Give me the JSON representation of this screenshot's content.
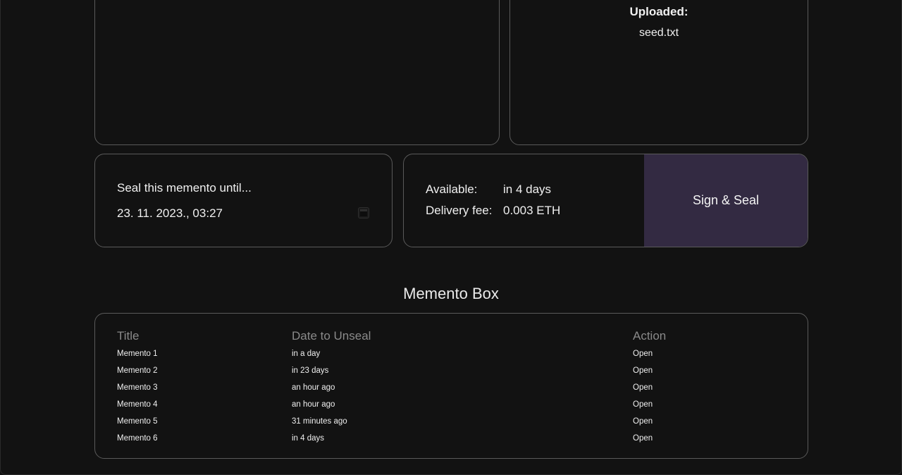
{
  "upload": {
    "uploaded_label": "Uploaded:",
    "file_name": "seed.txt"
  },
  "seal": {
    "label": "Seal this memento until...",
    "date_value": "23. 11. 2023., 03:27"
  },
  "delivery": {
    "available_label": "Available:",
    "available_value": "in 4 days",
    "fee_label": "Delivery fee:",
    "fee_value": "0.003 ETH",
    "sign_button_label": "Sign & Seal"
  },
  "memento_box": {
    "heading": "Memento Box",
    "columns": [
      "Title",
      "Date to Unseal",
      "Action"
    ],
    "rows": [
      {
        "title": "Memento 1",
        "date": "in a day",
        "action": "Open"
      },
      {
        "title": "Memento 2",
        "date": "in 23 days",
        "action": "Open"
      },
      {
        "title": "Memento 3",
        "date": "an hour ago",
        "action": "Open"
      },
      {
        "title": "Memento 4",
        "date": "an hour ago",
        "action": "Open"
      },
      {
        "title": "Memento 5",
        "date": "31 minutes ago",
        "action": "Open"
      },
      {
        "title": "Memento 6",
        "date": "in 4 days",
        "action": "Open"
      }
    ]
  },
  "colors": {
    "background": "#111111",
    "panel_border": "#5a5a5a",
    "accent_button": "#332a42",
    "header_text": "#8a8a8a"
  },
  "icons": {
    "calendar": "calendar-icon"
  }
}
